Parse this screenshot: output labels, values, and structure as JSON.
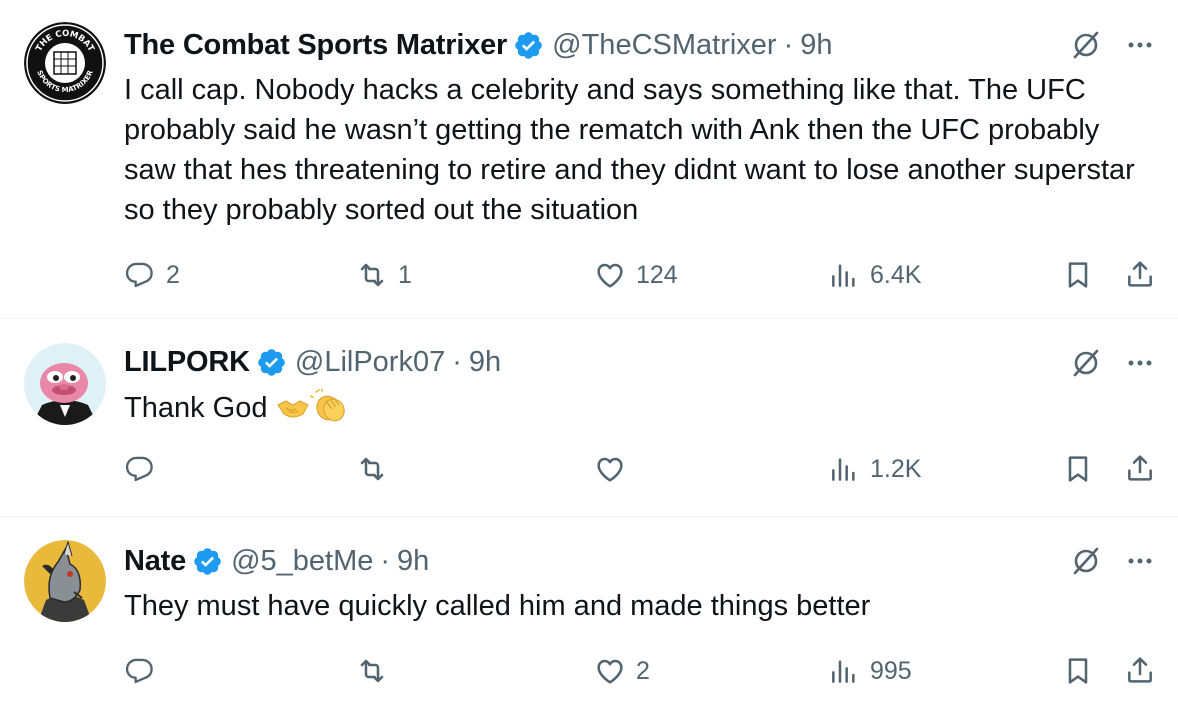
{
  "tweets": [
    {
      "name": "The Combat Sports Matrixer",
      "handle": "@TheCSMatrixer",
      "sep": "·",
      "time": "9h",
      "avatar_text_top": "THE COMBAT",
      "avatar_text_bottom": "SPORTS MATRIXER",
      "text": "I call cap. Nobody hacks a celebrity and says something like that. The UFC probably said he wasn’t getting the rematch with Ank then the UFC probably saw that hes threatening to retire and they didnt want to lose another superstar so they probably sorted out the situation",
      "replies": "2",
      "reposts": "1",
      "likes": "124",
      "views": "6.4K"
    },
    {
      "name": "LILPORK",
      "handle": "@LilPork07",
      "sep": "·",
      "time": "9h",
      "text": "Thank God",
      "emojis": [
        "handshake-emoji",
        "clapping-hands-emoji"
      ],
      "replies": "",
      "reposts": "",
      "likes": "",
      "views": "1.2K"
    },
    {
      "name": "Nate",
      "handle": "@5_betMe",
      "sep": "·",
      "time": "9h",
      "text": "They must have quickly called him and made things better",
      "replies": "",
      "reposts": "",
      "likes": "2",
      "views": "995"
    }
  ],
  "icons": {
    "verified": "verified-badge-icon",
    "grok": "grok-icon",
    "more": "more-icon",
    "reply": "reply-icon",
    "repost": "repost-icon",
    "like": "like-icon",
    "views": "views-icon",
    "bookmark": "bookmark-icon",
    "share": "share-icon"
  },
  "colors": {
    "text": "#0f1419",
    "secondary": "#536471",
    "verified": "#1d9bf0",
    "divider": "#eff3f4"
  }
}
